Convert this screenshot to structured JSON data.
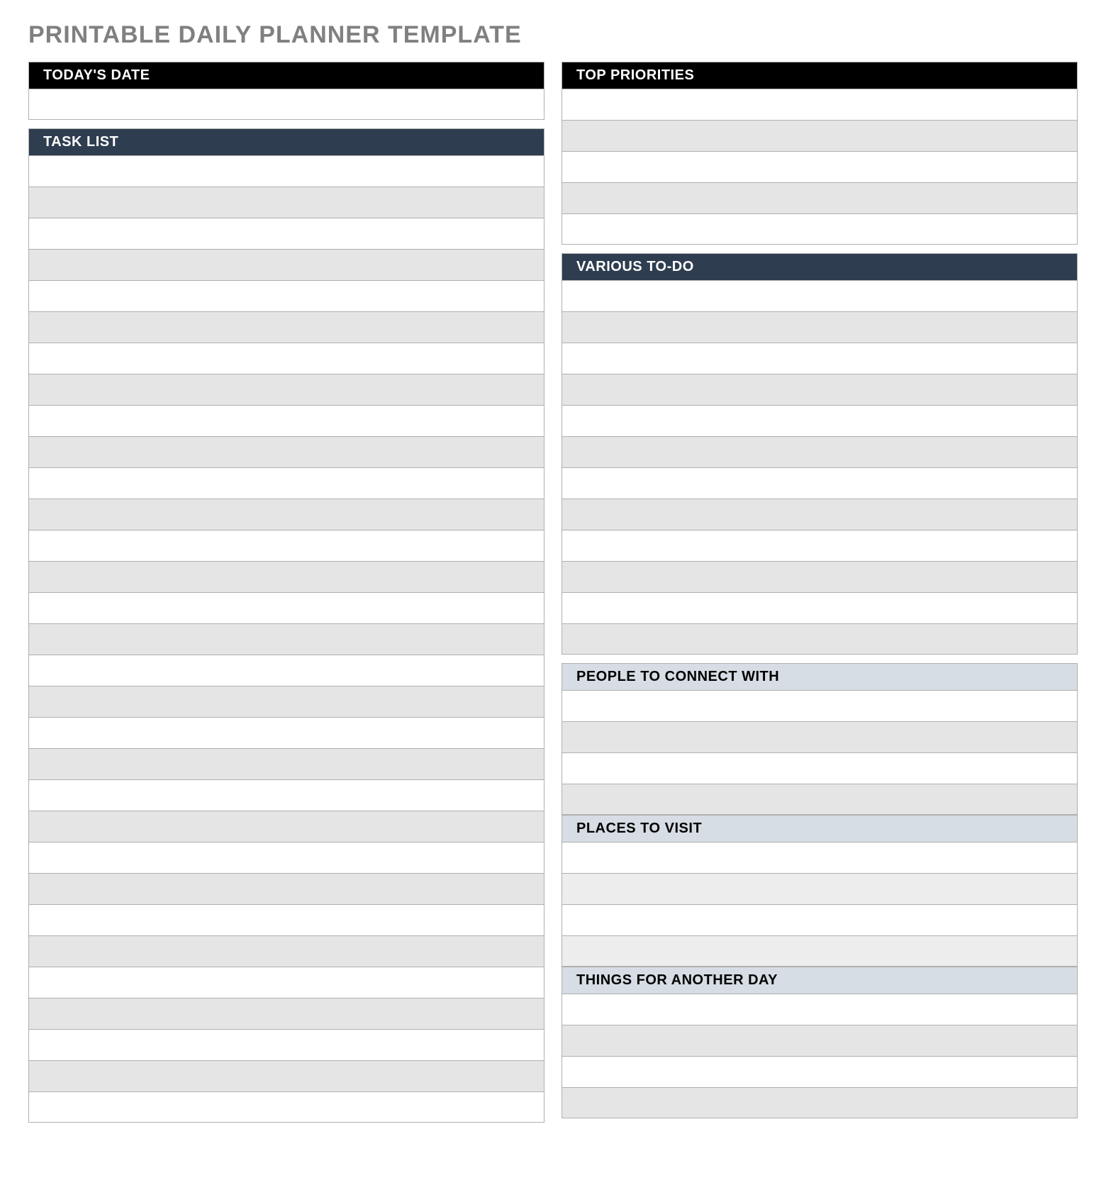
{
  "title": "PRINTABLE DAILY PLANNER TEMPLATE",
  "left": {
    "todays_date": {
      "label": "TODAY'S DATE",
      "rows": 1
    },
    "task_list": {
      "label": "TASK LIST",
      "rows": 31
    }
  },
  "right": {
    "top_priorities": {
      "label": "TOP PRIORITIES",
      "rows": 5,
      "pattern": "alt-start-white"
    },
    "various_todo": {
      "label": "VARIOUS TO-DO",
      "rows": 12,
      "pattern": "alt-start-white"
    },
    "people_connect": {
      "label": "PEOPLE TO CONNECT WITH",
      "rows": 4,
      "pattern": "alt-start-white"
    },
    "places_visit": {
      "label": "PLACES TO VISIT",
      "rows": 4,
      "pattern": "places"
    },
    "another_day": {
      "label": "THINGS FOR ANOTHER DAY",
      "rows": 4,
      "pattern": "alt-start-white"
    }
  }
}
